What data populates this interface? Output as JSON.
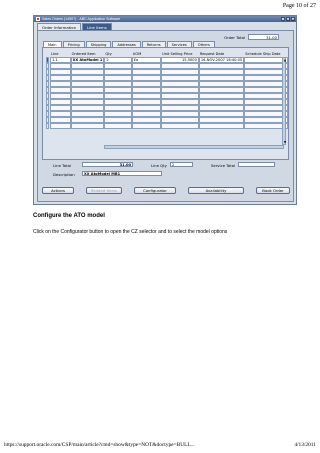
{
  "page_header": "Page 10 of 27",
  "footer": {
    "url": "https://support.oracle.com/CSP/main/article?cmd=show&type=NOT&doctype=BULL...",
    "date": "4/13/2011"
  },
  "window": {
    "title": "Sales Orders (1450?) - ABC Application Software",
    "controls": [
      "_",
      "□",
      "×"
    ]
  },
  "outer_tabs": [
    "Order Information",
    "Line Items"
  ],
  "order_total": {
    "label": "Order Total",
    "value": "31.00"
  },
  "sub_tabs": [
    "Main",
    "Pricing",
    "Shipping",
    "Addresses",
    "Returns",
    "Services",
    "Others"
  ],
  "table": {
    "headers": [
      "Line",
      "Ordered Item",
      "Qty",
      "UOM",
      "Unit Selling Price",
      "Request Date",
      "Schedule Ship Date"
    ],
    "first_row": {
      "line": "1.1",
      "item": "XX AtoModel 1",
      "qty": "2",
      "uom": "Ea",
      "price": "15.5000",
      "request_date": "16-NOV-2007 16:40:05",
      "schedule_date": ""
    },
    "empty_rows": 11
  },
  "summary": {
    "line_total_label": "Line Total",
    "line_total_value": "31.00",
    "line_qty_label": "Line Qty",
    "line_qty_value": "2",
    "service_total_label": "Service Total",
    "service_total_value": "",
    "description_label": "Description",
    "description_value": "XX AtoModel MB1"
  },
  "buttons": [
    {
      "label": "Actions",
      "enabled": true
    },
    {
      "label": "Related Items",
      "enabled": false
    },
    {
      "label": "Configurator",
      "enabled": true
    },
    {
      "label": "Availability",
      "enabled": true
    },
    {
      "label": "Book Order",
      "enabled": true
    }
  ],
  "heading": "Configure the ATO model",
  "instruction": "Click on the Configurator button to open the CZ selector and to select the model options"
}
